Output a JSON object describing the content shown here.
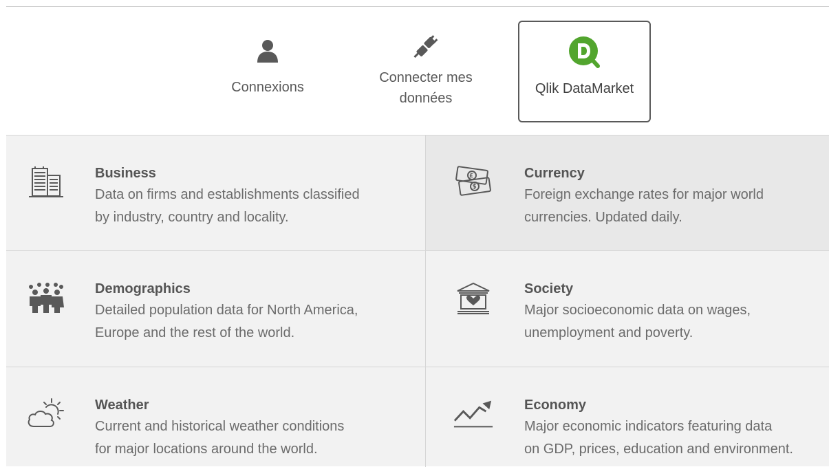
{
  "tabs": {
    "connections": {
      "label": "Connexions",
      "icon": "user-icon"
    },
    "connect_data": {
      "label_line1": "Connecter mes",
      "label_line2": "données",
      "icon": "plug-icon"
    },
    "datamarket": {
      "label": "Qlik DataMarket",
      "icon": "qlik-datamarket-logo",
      "color": "#52a52e"
    }
  },
  "categories": [
    {
      "title": "Business",
      "desc_line1": "Data on firms and establishments classified",
      "desc_line2": "by industry, country and locality.",
      "icon": "building-icon"
    },
    {
      "title": "Currency",
      "desc_line1": "Foreign exchange rates for major world",
      "desc_line2": "currencies. Updated daily.",
      "icon": "banknotes-icon"
    },
    {
      "title": "Demographics",
      "desc_line1": "Detailed population data for North America,",
      "desc_line2": "Europe and the rest of the world.",
      "icon": "people-icon"
    },
    {
      "title": "Society",
      "desc_line1": "Major socioeconomic data on wages,",
      "desc_line2": "unemployment and poverty.",
      "icon": "institution-heart-icon"
    },
    {
      "title": "Weather",
      "desc_line1": "Current and historical weather conditions",
      "desc_line2": "for major locations around the world.",
      "icon": "cloud-sun-icon"
    },
    {
      "title": "Economy",
      "desc_line1": "Major economic indicators featuring data",
      "desc_line2": "on GDP, prices, education and environment.",
      "icon": "trend-up-icon"
    }
  ],
  "colors": {
    "grid_bg": "#f2f2f2",
    "selected_bg": "#e8e8e8",
    "icon_gray": "#595959",
    "qlik_green": "#52a52e"
  }
}
